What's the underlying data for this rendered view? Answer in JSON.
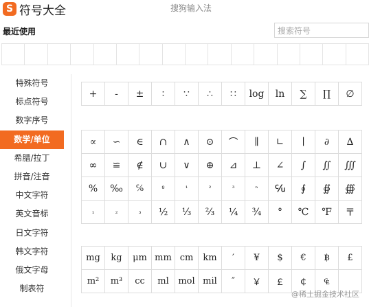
{
  "app": {
    "logo_char": "S",
    "title": "符号大全",
    "window_caption": "搜狗输入法"
  },
  "recent": {
    "label": "最近使用",
    "slots": 16
  },
  "search": {
    "placeholder": "搜索符号"
  },
  "sidebar": {
    "items": [
      {
        "label": "特殊符号",
        "active": false
      },
      {
        "label": "标点符号",
        "active": false
      },
      {
        "label": "数字序号",
        "active": false
      },
      {
        "label": "数学/单位",
        "active": true
      },
      {
        "label": "希腊/拉丁",
        "active": false
      },
      {
        "label": "拼音/注音",
        "active": false
      },
      {
        "label": "中文字符",
        "active": false
      },
      {
        "label": "英文音标",
        "active": false
      },
      {
        "label": "日文字符",
        "active": false
      },
      {
        "label": "韩文字符",
        "active": false
      },
      {
        "label": "俄文字母",
        "active": false
      },
      {
        "label": "制表符",
        "active": false
      }
    ]
  },
  "grids": [
    {
      "id": "operators",
      "rows": [
        [
          "+",
          "-",
          "±",
          "∶",
          "∵",
          "∴",
          "∷",
          "log",
          "ln",
          "∑",
          "∏",
          "∅"
        ]
      ]
    },
    {
      "id": "math-symbols",
      "rows": [
        [
          "∝",
          "∽",
          "∈",
          "∩",
          "∧",
          "⊙",
          "⌒",
          "∥",
          "∟",
          "∣",
          "∂",
          "∆"
        ],
        [
          "∞",
          "≌",
          "∉",
          "∪",
          "∨",
          "⊕",
          "⊿",
          "⊥",
          "∠",
          "∫",
          "∬",
          "∭"
        ],
        [
          "%",
          "‰",
          "℅",
          "º",
          "¹",
          "²",
          "³",
          "ⁿ",
          "℆",
          "∮",
          "∯",
          "∰"
        ],
        [
          "₁",
          "₂",
          "₃",
          "½",
          "⅓",
          "⅔",
          "¼",
          "¾",
          "°",
          "℃",
          "℉",
          "〒"
        ]
      ]
    },
    {
      "id": "units-currency",
      "rows": [
        [
          "mg",
          "kg",
          "μm",
          "mm",
          "cm",
          "km",
          "′",
          "¥",
          "$",
          "€",
          "฿",
          "£"
        ],
        [
          "m²",
          "m³",
          "cc",
          "ml",
          "mol",
          "mil",
          "″",
          "￥",
          "￡",
          "￠",
          "₠",
          ""
        ]
      ]
    }
  ],
  "watermark": "@稀土掘金技术社区"
}
